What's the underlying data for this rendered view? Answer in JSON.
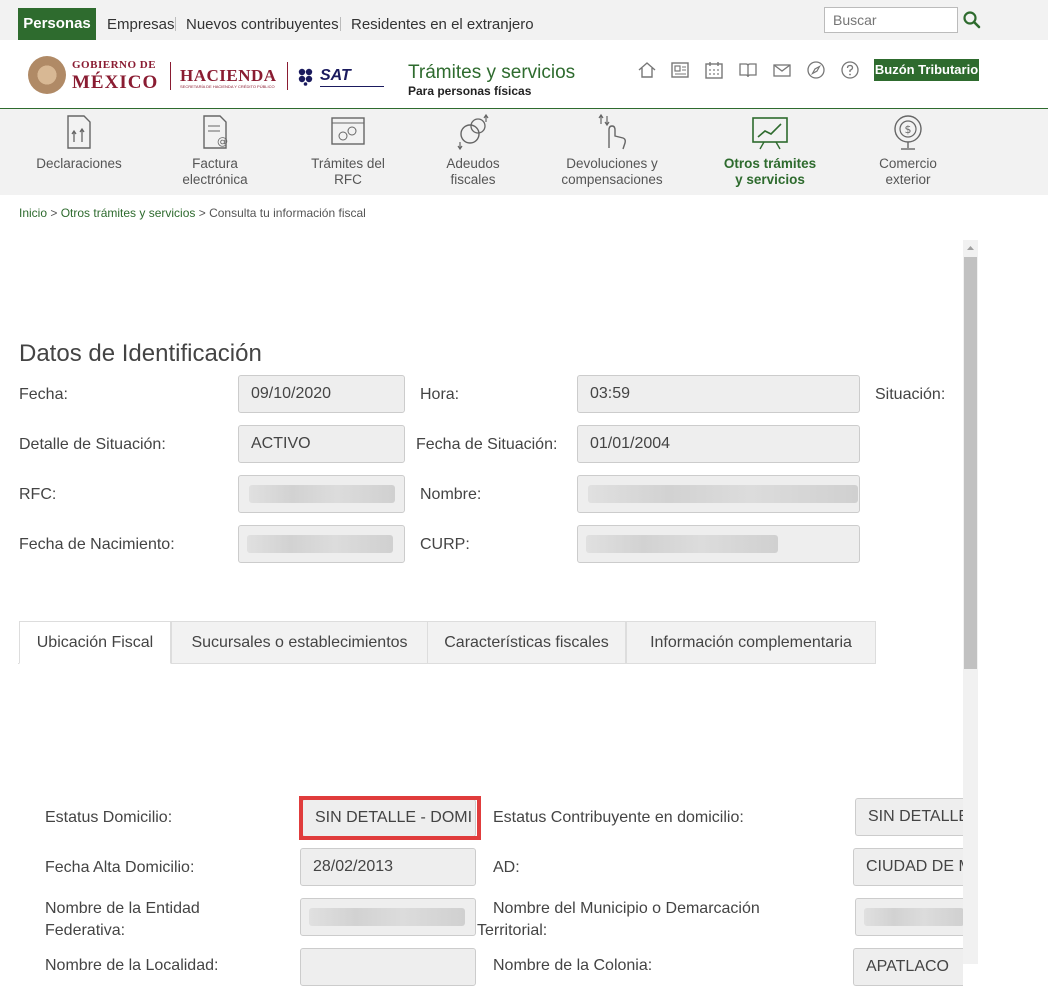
{
  "topnav": {
    "active": "Personas",
    "links": [
      "Empresas",
      "Nuevos contribuyentes",
      "Residentes en el extranjero"
    ],
    "search_placeholder": "Buscar"
  },
  "header": {
    "gob_line1": "GOBIERNO DE",
    "gob_line2": "MÉXICO",
    "hacienda": "HACIENDA",
    "hacienda_sub": "SECRETARÍA DE HACIENDA Y CRÉDITO PÚBLICO",
    "sat": "SAT",
    "title": "Trámites y servicios",
    "subtitle": "Para personas físicas",
    "buzon": "Buzón Tributario",
    "icons": [
      "home-icon",
      "news-icon",
      "calendar-icon",
      "book-icon",
      "mail-icon",
      "compass-icon",
      "help-icon"
    ]
  },
  "nav": [
    {
      "line1": "Declaraciones",
      "line2": ""
    },
    {
      "line1": "Factura",
      "line2": "electrónica"
    },
    {
      "line1": "Trámites del",
      "line2": "RFC"
    },
    {
      "line1": "Adeudos",
      "line2": "fiscales"
    },
    {
      "line1": "Devoluciones y",
      "line2": "compensaciones"
    },
    {
      "line1": "Otros trámites",
      "line2": "y servicios"
    },
    {
      "line1": "Comercio",
      "line2": "exterior"
    }
  ],
  "breadcrumb": {
    "items": [
      "Inicio",
      "Otros trámites y servicios"
    ],
    "current": "Consulta tu información fiscal",
    "separator": " > "
  },
  "identificacion": {
    "title": "Datos de Identificación",
    "fecha_label": "Fecha:",
    "fecha": "09/10/2020",
    "hora_label": "Hora:",
    "hora": "03:59",
    "situacion_label": "Situación:",
    "detalle_label": "Detalle de Situación:",
    "detalle": "ACTIVO",
    "fecha_situacion_label": "Fecha de Situación:",
    "fecha_situacion": "01/01/2004",
    "rfc_label": "RFC:",
    "nombre_label": "Nombre:",
    "nacimiento_label": "Fecha de Nacimiento:",
    "curp_label": "CURP:"
  },
  "tabs": [
    "Ubicación Fiscal",
    "Sucursales o establecimientos",
    "Características fiscales",
    "Información complementaria"
  ],
  "ubicacion": {
    "estatus_domicilio_label": "Estatus Domicilio:",
    "estatus_domicilio": "SIN DETALLE - DOMI",
    "estatus_contrib_label": "Estatus Contribuyente en domicilio:",
    "estatus_contrib": "SIN DETALLE",
    "fecha_alta_label": "Fecha Alta Domicilio:",
    "fecha_alta": "28/02/2013",
    "ad_label": "AD:",
    "ad": "CIUDAD DE M",
    "entidad_label_1": "Nombre de la Entidad",
    "entidad_label_2": "Federativa:",
    "municipio_label_1": "Nombre del Municipio o Demarcación",
    "municipio_label_2": "Territorial:",
    "localidad_label": "Nombre de la Localidad:",
    "colonia_label": "Nombre de la Colonia:",
    "colonia": "APATLACO"
  }
}
